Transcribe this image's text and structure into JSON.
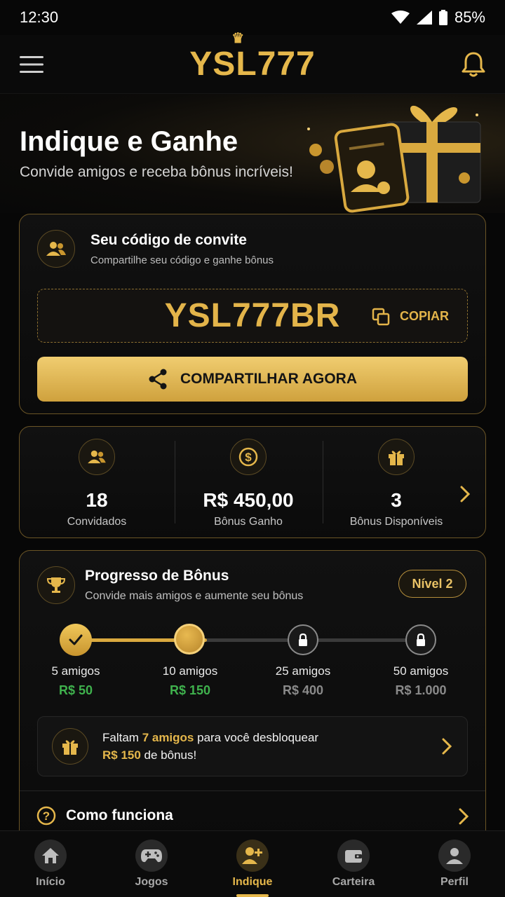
{
  "status_bar": {
    "time": "12:30",
    "battery": "85%"
  },
  "header": {
    "logo": "YSL777"
  },
  "hero": {
    "title": "Indique e Ganhe",
    "subtitle": "Convide amigos e receba bônus incríveis!"
  },
  "invite": {
    "title": "Seu código de convite",
    "subtitle": "Compartilhe seu código e ganhe bônus",
    "code": "YSL777BR",
    "copy_label": "COPIAR",
    "share_label": "COMPARTILHAR AGORA"
  },
  "stats": [
    {
      "value": "18",
      "label": "Convidados",
      "icon": "users-icon"
    },
    {
      "value": "R$ 450,00",
      "label": "Bônus Ganho",
      "icon": "dollar-icon"
    },
    {
      "value": "3",
      "label": "Bônus Disponíveis",
      "icon": "gift-icon"
    }
  ],
  "progress": {
    "title": "Progresso de Bônus",
    "subtitle": "Convide mais amigos e aumente seu bônus",
    "level": "Nível 2",
    "fill_fraction": 0.38,
    "milestones": [
      {
        "label": "5 amigos",
        "reward": "R$ 50",
        "state": "done"
      },
      {
        "label": "10 amigos",
        "reward": "R$ 150",
        "state": "current"
      },
      {
        "label": "25 amigos",
        "reward": "R$ 400",
        "state": "locked"
      },
      {
        "label": "50 amigos",
        "reward": "R$ 1.000",
        "state": "locked"
      }
    ],
    "unlock": {
      "pre": "Faltam ",
      "friends": "7 amigos",
      "mid": " para você desbloquear",
      "amount": "R$ 150",
      "post": " de bônus!"
    }
  },
  "how_it_works": {
    "label": "Como funciona"
  },
  "nav": [
    {
      "label": "Início",
      "icon": "home-icon",
      "active": false
    },
    {
      "label": "Jogos",
      "icon": "gamepad-icon",
      "active": false
    },
    {
      "label": "Indique",
      "icon": "add-user-icon",
      "active": true
    },
    {
      "label": "Carteira",
      "icon": "wallet-icon",
      "active": false
    },
    {
      "label": "Perfil",
      "icon": "profile-icon",
      "active": false
    }
  ],
  "colors": {
    "gold": "#e5b74b",
    "green": "#3fb24d",
    "background": "#070707"
  }
}
